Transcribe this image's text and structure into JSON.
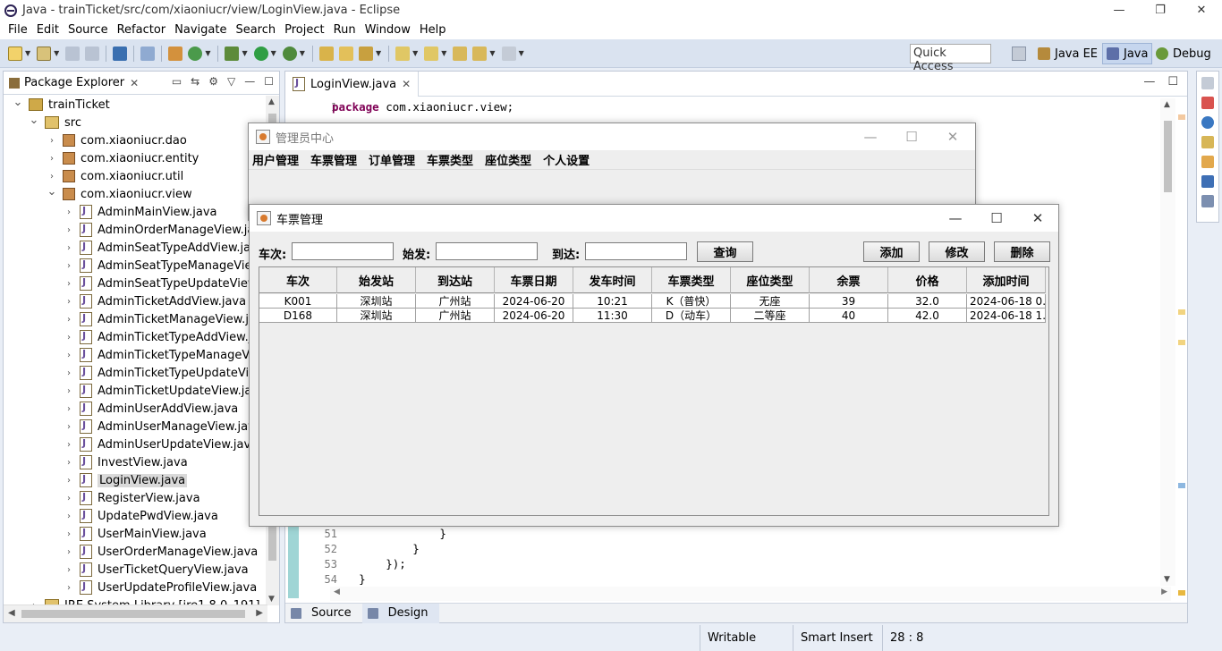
{
  "eclipse": {
    "title": "Java - trainTicket/src/com/xiaoniucr/view/LoginView.java - Eclipse",
    "menu": [
      "File",
      "Edit",
      "Source",
      "Refactor",
      "Navigate",
      "Search",
      "Project",
      "Run",
      "Window",
      "Help"
    ],
    "quick_access": "Quick Access",
    "perspectives": [
      "Java EE",
      "Java",
      "Debug"
    ]
  },
  "package_explorer": {
    "tab": "Package Explorer",
    "items": [
      {
        "label": "trainTicket",
        "type": "project",
        "depth": 0,
        "expanded": true
      },
      {
        "label": "src",
        "type": "src",
        "depth": 1,
        "expanded": true
      },
      {
        "label": "com.xiaoniucr.dao",
        "type": "package",
        "depth": 2,
        "expanded": false
      },
      {
        "label": "com.xiaoniucr.entity",
        "type": "package",
        "depth": 2,
        "expanded": false
      },
      {
        "label": "com.xiaoniucr.util",
        "type": "package",
        "depth": 2,
        "expanded": false
      },
      {
        "label": "com.xiaoniucr.view",
        "type": "package",
        "depth": 2,
        "expanded": true
      },
      {
        "label": "AdminMainView.java",
        "type": "java",
        "depth": 3
      },
      {
        "label": "AdminOrderManageView.java",
        "type": "java",
        "depth": 3
      },
      {
        "label": "AdminSeatTypeAddView.java",
        "type": "java",
        "depth": 3
      },
      {
        "label": "AdminSeatTypeManageView.ja",
        "type": "java",
        "depth": 3
      },
      {
        "label": "AdminSeatTypeUpdateView.ja",
        "type": "java",
        "depth": 3
      },
      {
        "label": "AdminTicketAddView.java",
        "type": "java",
        "depth": 3
      },
      {
        "label": "AdminTicketManageView.java",
        "type": "java",
        "depth": 3
      },
      {
        "label": "AdminTicketTypeAddView.jav",
        "type": "java",
        "depth": 3
      },
      {
        "label": "AdminTicketTypeManageView",
        "type": "java",
        "depth": 3
      },
      {
        "label": "AdminTicketTypeUpdateView.",
        "type": "java",
        "depth": 3
      },
      {
        "label": "AdminTicketUpdateView.java",
        "type": "java",
        "depth": 3
      },
      {
        "label": "AdminUserAddView.java",
        "type": "java",
        "depth": 3
      },
      {
        "label": "AdminUserManageView.java",
        "type": "java",
        "depth": 3
      },
      {
        "label": "AdminUserUpdateView.java",
        "type": "java",
        "depth": 3
      },
      {
        "label": "InvestView.java",
        "type": "java",
        "depth": 3
      },
      {
        "label": "LoginView.java",
        "type": "java",
        "depth": 3,
        "selected": true
      },
      {
        "label": "RegisterView.java",
        "type": "java",
        "depth": 3
      },
      {
        "label": "UpdatePwdView.java",
        "type": "java",
        "depth": 3
      },
      {
        "label": "UserMainView.java",
        "type": "java",
        "depth": 3
      },
      {
        "label": "UserOrderManageView.java",
        "type": "java",
        "depth": 3
      },
      {
        "label": "UserTicketQueryView.java",
        "type": "java",
        "depth": 3
      },
      {
        "label": "UserUpdateProfileView.java",
        "type": "java",
        "depth": 3
      },
      {
        "label": "JRE System Library [jre1.8.0_191]",
        "type": "lib",
        "depth": 1,
        "expanded": false
      }
    ]
  },
  "editor": {
    "tab": "LoginView.java",
    "lines": [
      {
        "n": "1",
        "code": "package com.xiaoniucr.view;"
      },
      {
        "n": "51",
        "code": "                }"
      },
      {
        "n": "52",
        "code": "            }"
      },
      {
        "n": "53",
        "code": "        });"
      },
      {
        "n": "54",
        "code": "    }"
      }
    ],
    "bottom_tabs": [
      "Source",
      "Design"
    ]
  },
  "status": {
    "writable": "Writable",
    "insert": "Smart Insert",
    "pos": "28 : 8"
  },
  "admin_window": {
    "title": "管理员中心",
    "menu": [
      "用户管理",
      "车票管理",
      "订单管理",
      "车票类型",
      "座位类型",
      "个人设置"
    ]
  },
  "ticket_window": {
    "title": "车票管理",
    "search": {
      "train_label": "车次:",
      "from_label": "始发:",
      "to_label": "到达:",
      "train": "",
      "from": "",
      "to": ""
    },
    "buttons": {
      "query": "查询",
      "add": "添加",
      "edit": "修改",
      "delete": "删除"
    },
    "table": {
      "columns": [
        "车次",
        "始发站",
        "到达站",
        "车票日期",
        "发车时间",
        "车票类型",
        "座位类型",
        "余票",
        "价格",
        "添加时间"
      ],
      "rows": [
        [
          "K001",
          "深圳站",
          "广州站",
          "2024-06-20",
          "10:21",
          "K（普快）",
          "无座",
          "39",
          "32.0",
          "2024-06-18 0..."
        ],
        [
          "D168",
          "深圳站",
          "广州站",
          "2024-06-20",
          "11:30",
          "D（动车）",
          "二等座",
          "40",
          "42.0",
          "2024-06-18 1..."
        ]
      ]
    }
  }
}
